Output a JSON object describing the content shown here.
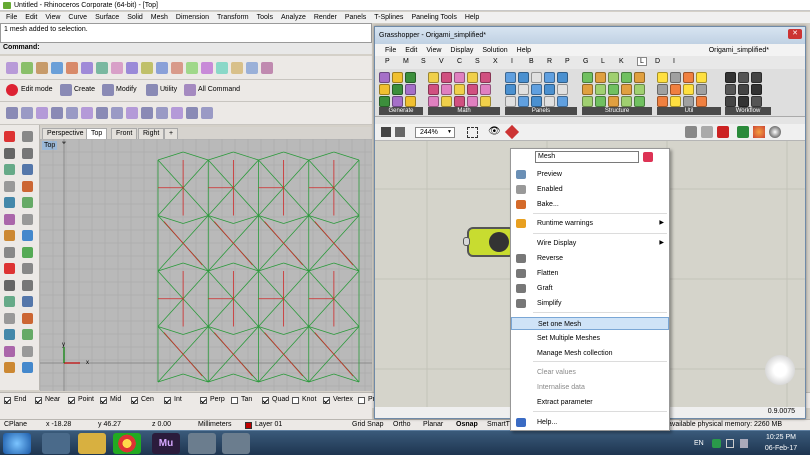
{
  "window": {
    "title": "Untitled - Rhinoceros Corporate (64-bit) - [Top]"
  },
  "rhino_menu": [
    "File",
    "Edit",
    "View",
    "Curve",
    "Surface",
    "Solid",
    "Mesh",
    "Dimension",
    "Transform",
    "Tools",
    "Analyze",
    "Render",
    "Panels",
    "T-Splines",
    "Paneling Tools",
    "Help"
  ],
  "command_history": "1 mesh added to selection.",
  "command_prompt": "Command:",
  "tabs_toolbar": {
    "edit_mode": "Edit mode",
    "create": "Create",
    "modify": "Modify",
    "utility": "Utility",
    "all_command": "All Command"
  },
  "viewport_tabs": [
    "Perspective",
    "Top",
    "Front",
    "Right",
    "+"
  ],
  "viewport": {
    "name": "Top",
    "axis_x": "x",
    "axis_y": "y"
  },
  "osnaps": [
    {
      "label": "End",
      "checked": true
    },
    {
      "label": "Near",
      "checked": true
    },
    {
      "label": "Point",
      "checked": true
    },
    {
      "label": "Mid",
      "checked": true
    },
    {
      "label": "Cen",
      "checked": true
    },
    {
      "label": "Int",
      "checked": true
    },
    {
      "label": "Perp",
      "checked": true
    },
    {
      "label": "Tan",
      "checked": false
    },
    {
      "label": "Quad",
      "checked": true
    },
    {
      "label": "Knot",
      "checked": false
    },
    {
      "label": "Vertex",
      "checked": true
    },
    {
      "label": "Project",
      "checked": false
    },
    {
      "label": "Disable",
      "checked": false
    }
  ],
  "status": {
    "cplane": "CPlane",
    "x": "x -18.28",
    "y": "y 46.27",
    "z": "z 0.00",
    "units": "Millimeters",
    "layer": "Layer 01",
    "layer_color": "#c00000",
    "grid_snap": "Grid Snap",
    "ortho": "Ortho",
    "planar": "Planar",
    "osnap": "Osnap",
    "smart": "SmartT",
    "memory": "available physical memory: 2260 MB"
  },
  "grasshopper": {
    "title": "Grasshopper - Origami_simplified*",
    "menu": [
      "File",
      "Edit",
      "View",
      "Display",
      "Solution",
      "Help"
    ],
    "file_name": "Origami_simplified*",
    "tabs": [
      "P",
      "M",
      "S",
      "V",
      "C",
      "S",
      "X",
      "I",
      "B",
      "R",
      "P",
      "G",
      "L",
      "K",
      "L",
      "D",
      "I"
    ],
    "active_tab_index": 14,
    "groups": [
      "Generate",
      "Math",
      "Panels",
      "Structure",
      "Util",
      "Workflow"
    ],
    "zoom": "244%",
    "version": "0.9.0075"
  },
  "context_menu": {
    "name_value": "Mesh",
    "items": [
      {
        "label": "Preview",
        "icon": "preview-icon",
        "color": "#6a8fb5"
      },
      {
        "label": "Enabled",
        "icon": "enabled-icon",
        "color": ""
      },
      {
        "label": "Bake...",
        "icon": "bake-icon",
        "color": "#d46a2a"
      },
      {
        "label": "Runtime warnings",
        "icon": "warning-icon",
        "color": "#e8a020",
        "submenu": true
      },
      {
        "label": "Wire Display",
        "icon": "",
        "color": "",
        "submenu": true
      },
      {
        "label": "Reverse",
        "icon": "reverse-icon",
        "color": "#777"
      },
      {
        "label": "Flatten",
        "icon": "flatten-icon",
        "color": "#777"
      },
      {
        "label": "Graft",
        "icon": "graft-icon",
        "color": "#777"
      },
      {
        "label": "Simplify",
        "icon": "simplify-icon",
        "color": "#777"
      },
      {
        "label": "Set one Mesh",
        "icon": "",
        "color": "",
        "highlight": true
      },
      {
        "label": "Set Multiple Meshes",
        "icon": "",
        "color": ""
      },
      {
        "label": "Manage Mesh collection",
        "icon": "",
        "color": ""
      },
      {
        "label": "Clear values",
        "icon": "",
        "color": "",
        "disabled": true
      },
      {
        "label": "Internalise data",
        "icon": "",
        "color": "",
        "disabled": true
      },
      {
        "label": "Extract parameter",
        "icon": "",
        "color": ""
      },
      {
        "label": "Help...",
        "icon": "help-icon",
        "color": "#3a6bc4"
      }
    ]
  },
  "taskbar": {
    "time": "10:25 PM",
    "date": "06-Feb-17",
    "lang": "EN"
  }
}
